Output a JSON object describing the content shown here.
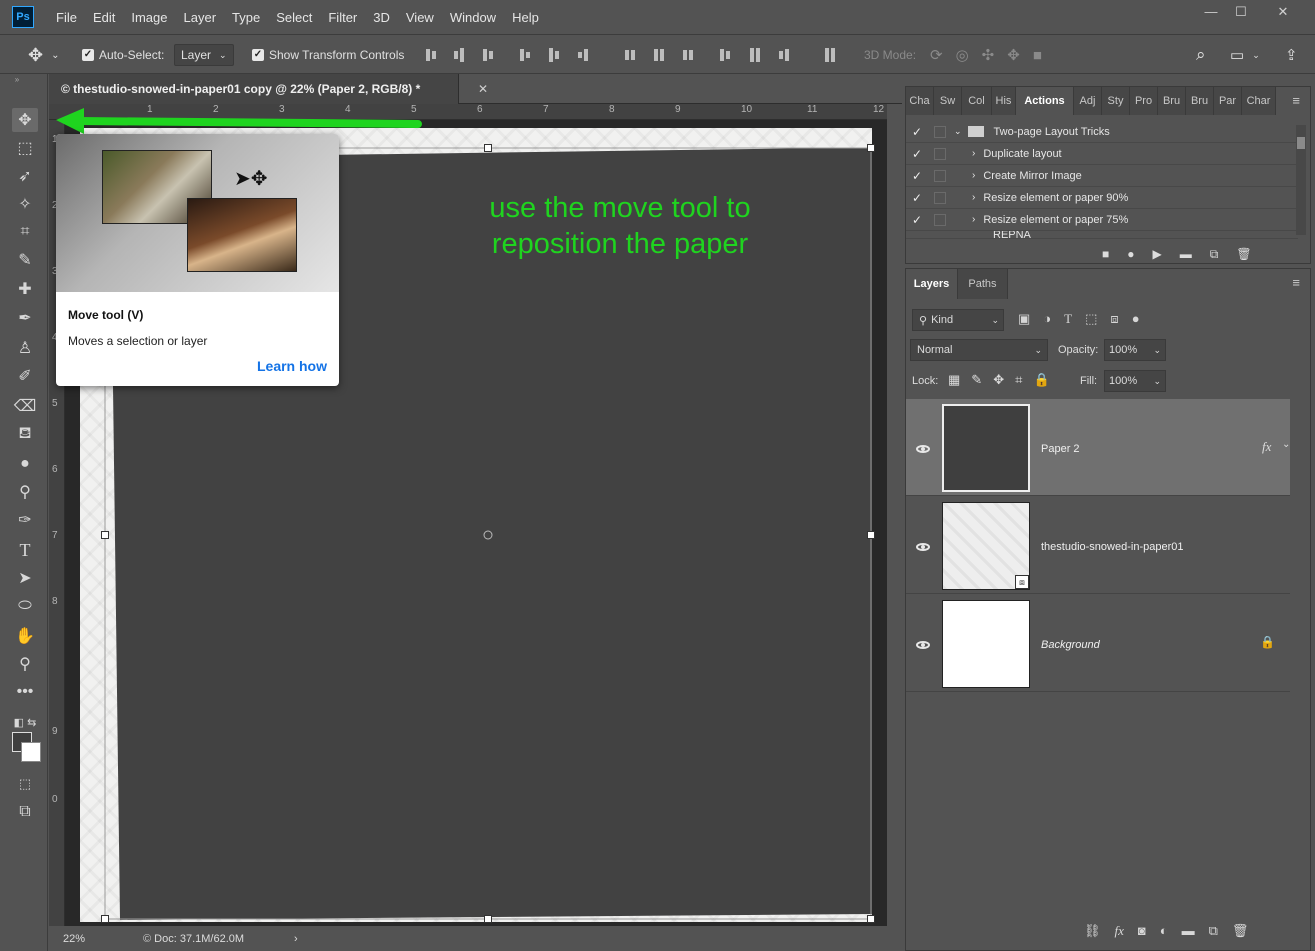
{
  "app": {
    "logo": "Ps"
  },
  "menu": [
    "File",
    "Edit",
    "Image",
    "Layer",
    "Type",
    "Select",
    "Filter",
    "3D",
    "View",
    "Window",
    "Help"
  ],
  "window_controls": [
    "—",
    "☐",
    "✕"
  ],
  "options": {
    "auto_select_label": "Auto-Select:",
    "auto_select_value": "Layer",
    "show_transform_label": "Show Transform Controls",
    "mode_3d_label": "3D Mode:"
  },
  "document": {
    "tab_title": "© thestudio-snowed-in-paper01 copy @ 22% (Paper 2, RGB/8) *",
    "tab_close": "✕",
    "ruler_numbers": [
      "1",
      "2",
      "3",
      "4",
      "5",
      "6",
      "7",
      "8",
      "9",
      "10",
      "11",
      "12"
    ],
    "left_ruler_numbers": [
      "1",
      "2",
      "3",
      "4",
      "5",
      "6",
      "7",
      "8",
      "9",
      "0"
    ]
  },
  "annotation": {
    "line1": "use the move tool to",
    "line2": "reposition the paper"
  },
  "tooltip": {
    "title": "Move tool (V)",
    "description": "Moves a selection or layer",
    "link": "Learn how"
  },
  "status": {
    "zoom": "22%",
    "doc": "Doc: 37.1M/62.0M",
    "arrow": "›"
  },
  "actions_panel": {
    "tabs": [
      "Cha",
      "Sw",
      "Col",
      "His",
      "Actions",
      "Adj",
      "Sty",
      "Pro",
      "Bru",
      "Bru",
      "Par",
      "Char"
    ],
    "active_tab": "Actions",
    "set_name": "Two-page Layout Tricks",
    "items": [
      "Duplicate layout",
      "Create Mirror Image",
      "Resize element or paper 90%",
      "Resize element or paper 75%"
    ],
    "partial_item": "REPNA"
  },
  "layers_panel": {
    "tabs": [
      "Layers",
      "Paths"
    ],
    "filter_kind": "Kind",
    "blend_mode": "Normal",
    "opacity_label": "Opacity:",
    "opacity_value": "100%",
    "lock_label": "Lock:",
    "fill_label": "Fill:",
    "fill_value": "100%",
    "fx_label": "fx",
    "layers": [
      {
        "name": "Paper 2",
        "selected": true,
        "fx": true
      },
      {
        "name": "thestudio-snowed-in-paper01",
        "selected": false
      },
      {
        "name": "Background",
        "selected": false,
        "locked": true
      }
    ]
  },
  "colors": {
    "accent_green": "#1fd41f",
    "link_blue": "#1473e6",
    "canvas_dark": "#424242"
  }
}
